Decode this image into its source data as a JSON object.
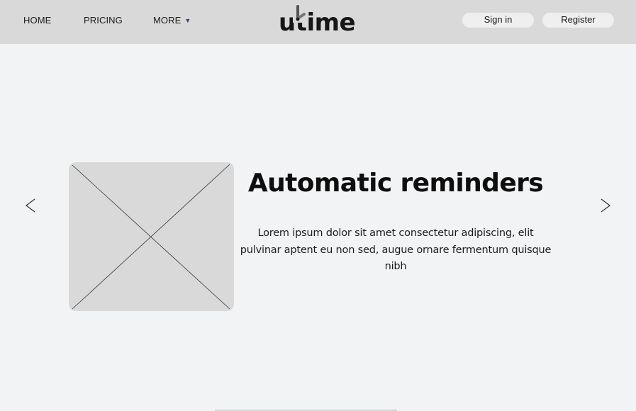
{
  "nav": {
    "home": "HOME",
    "pricing": "PRICING",
    "more": "MORE",
    "more_caret": "▼"
  },
  "logo": {
    "text": "utime",
    "mark_icon": "clock-hand-icon"
  },
  "auth": {
    "sign_in": "Sign in",
    "register": "Register"
  },
  "carousel": {
    "prev_icon": "chevron-left-icon",
    "next_icon": "chevron-right-icon",
    "image_icon": "image-placeholder-icon",
    "title": "Automatic reminders",
    "body": "Lorem ipsum dolor sit amet consectetur adipiscing, elit pulvinar aptent eu non sed, augue ornare fermentum quisque nibh"
  },
  "colors": {
    "header_bg": "#d9d9d9",
    "page_bg": "#f2f3f5",
    "accent": "#3b3a8f",
    "button_bg": "#efefef"
  }
}
